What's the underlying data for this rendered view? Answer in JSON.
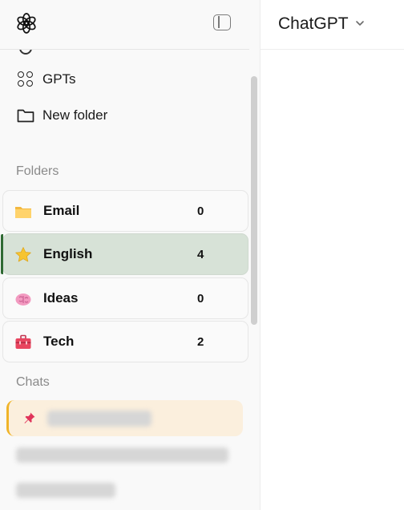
{
  "sidebar": {
    "nav": [
      {
        "label": "GPTs",
        "icon": "gpts-grid-icon"
      },
      {
        "label": "New folder",
        "icon": "folder-outline-icon"
      }
    ],
    "folders_label": "Folders",
    "folders": [
      {
        "name": "Email",
        "count": "0",
        "icon": "folder-emoji-icon",
        "active": false
      },
      {
        "name": "English",
        "count": "4",
        "icon": "star-emoji-icon",
        "active": true
      },
      {
        "name": "Ideas",
        "count": "0",
        "icon": "brain-emoji-icon",
        "active": false
      },
      {
        "name": "Tech",
        "count": "2",
        "icon": "toolbox-emoji-icon",
        "active": false
      }
    ],
    "chats_label": "Chats"
  },
  "header": {
    "model_name": "ChatGPT"
  },
  "colors": {
    "active_folder_bg": "#d7e2d7",
    "active_folder_accent": "#2f6a33",
    "pinned_chat_bg": "#fbefdd",
    "pinned_chat_accent": "#f0b429"
  }
}
